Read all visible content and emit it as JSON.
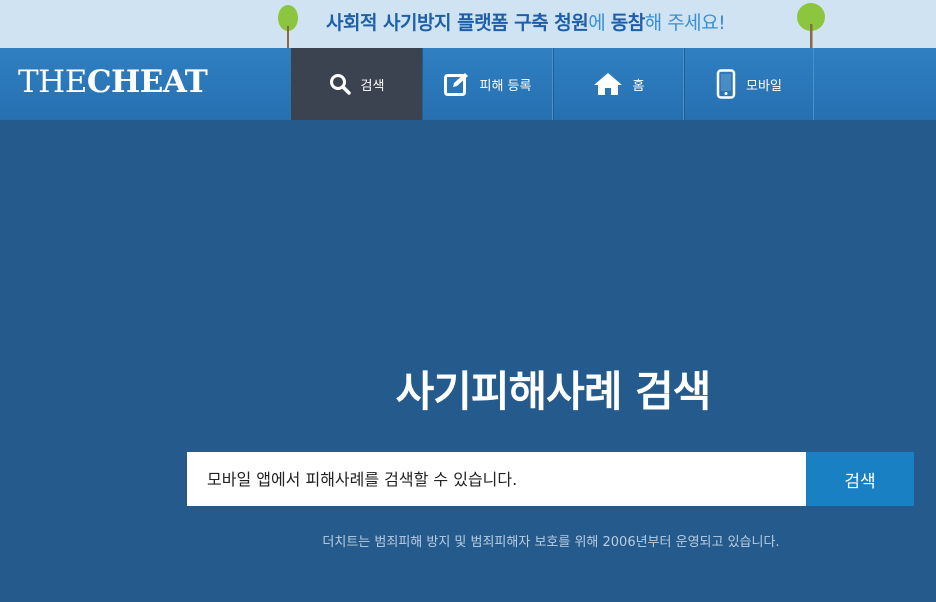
{
  "banner": {
    "part1": "사회적 사기방지 플랫폼 구축 청원",
    "part2": "에 ",
    "part3": "동참",
    "part4": "해 주세요!"
  },
  "logo": {
    "the": "THE",
    "cheat": "CHEAT"
  },
  "nav": {
    "items": [
      {
        "label": "검색",
        "icon": "search-icon"
      },
      {
        "label": "피해 등록",
        "icon": "edit-icon"
      },
      {
        "label": "홈",
        "icon": "home-icon"
      },
      {
        "label": "모바일",
        "icon": "mobile-icon"
      }
    ]
  },
  "main": {
    "headline": "사기피해사례 검색",
    "search_placeholder": "모바일 앱에서 피해사례를 검색할 수 있습니다.",
    "search_button": "검색",
    "notice": "더치트는 범죄피해 방지 및 범죄피해자 보호를 위해 2006년부터 운영되고 있습니다."
  },
  "colors": {
    "background": "#245a8c",
    "banner": "#cfe3f3",
    "nav": "#2a76b8",
    "nav_active": "#3c4350",
    "search_button": "#1a80c4"
  }
}
